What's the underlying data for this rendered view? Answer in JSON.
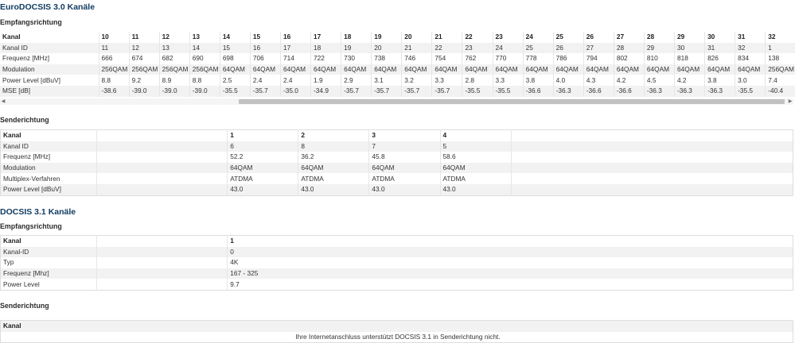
{
  "eurodocsis": {
    "title": "EuroDOCSIS 3.0 Kanäle",
    "downstream": {
      "title": "Empfangsrichtung",
      "header": [
        "Kanal",
        "10",
        "11",
        "12",
        "13",
        "14",
        "15",
        "16",
        "17",
        "18",
        "19",
        "20",
        "21",
        "22",
        "23",
        "24",
        "25",
        "26",
        "27",
        "28",
        "29",
        "30",
        "31",
        "32"
      ],
      "rows": [
        [
          "Kanal ID",
          "11",
          "12",
          "13",
          "14",
          "15",
          "16",
          "17",
          "18",
          "19",
          "20",
          "21",
          "22",
          "23",
          "24",
          "25",
          "26",
          "27",
          "28",
          "29",
          "30",
          "31",
          "32",
          "1"
        ],
        [
          "Frequenz [MHz]",
          "666",
          "674",
          "682",
          "690",
          "698",
          "706",
          "714",
          "722",
          "730",
          "738",
          "746",
          "754",
          "762",
          "770",
          "778",
          "786",
          "794",
          "802",
          "810",
          "818",
          "826",
          "834",
          "138"
        ],
        [
          "Modulation",
          "256QAM",
          "256QAM",
          "256QAM",
          "256QAM",
          "64QAM",
          "64QAM",
          "64QAM",
          "64QAM",
          "64QAM",
          "64QAM",
          "64QAM",
          "64QAM",
          "64QAM",
          "64QAM",
          "64QAM",
          "64QAM",
          "64QAM",
          "64QAM",
          "64QAM",
          "64QAM",
          "64QAM",
          "64QAM",
          "256QAM"
        ],
        [
          "Power Level [dBuV]",
          "8.8",
          "9.2",
          "8.9",
          "8.8",
          "2.5",
          "2.4",
          "2.4",
          "1.9",
          "2.9",
          "3.1",
          "3.2",
          "3.3",
          "2.8",
          "3.3",
          "3.8",
          "4.0",
          "4.3",
          "4.2",
          "4.5",
          "4.2",
          "3.8",
          "3.0",
          "7.4"
        ],
        [
          "MSE [dB]",
          "-38.6",
          "-39.0",
          "-39.0",
          "-39.0",
          "-35.5",
          "-35.7",
          "-35.0",
          "-34.9",
          "-35.7",
          "-35.7",
          "-35.7",
          "-35.7",
          "-35.5",
          "-35.5",
          "-36.6",
          "-36.3",
          "-36.6",
          "-36.6",
          "-36.3",
          "-36.3",
          "-36.3",
          "-35.5",
          "-40.4"
        ]
      ]
    },
    "upstream": {
      "title": "Senderichtung",
      "header": [
        "Kanal",
        "",
        "1",
        "2",
        "3",
        "4",
        ""
      ],
      "rows": [
        [
          "Kanal ID",
          "",
          "6",
          "8",
          "7",
          "5",
          ""
        ],
        [
          "Frequenz [MHz]",
          "",
          "52.2",
          "36.2",
          "45.8",
          "58.6",
          ""
        ],
        [
          "Modulation",
          "",
          "64QAM",
          "64QAM",
          "64QAM",
          "64QAM",
          ""
        ],
        [
          "Multiplex-Verfahren",
          "",
          "ATDMA",
          "ATDMA",
          "ATDMA",
          "ATDMA",
          ""
        ],
        [
          "Power Level [dBuV]",
          "",
          "43.0",
          "43.0",
          "43.0",
          "43.0",
          ""
        ]
      ]
    }
  },
  "docsis31": {
    "title": "DOCSIS 3.1 Kanäle",
    "downstream": {
      "title": "Empfangsrichtung",
      "header": [
        "Kanal",
        "",
        "1"
      ],
      "rows": [
        [
          "Kanal-ID",
          "",
          "0"
        ],
        [
          "Typ",
          "",
          "4K"
        ],
        [
          "Frequenz [Mhz]",
          "",
          "167 - 325"
        ],
        [
          "Power Level",
          "",
          "9.7"
        ]
      ]
    },
    "upstream": {
      "title": "Senderichtung",
      "header": [
        "Kanal"
      ],
      "note": "Ihre Internetanschluss unterstützt DOCSIS 3.1 in Senderichtung nicht."
    }
  },
  "scrollbar": {
    "left_arrow": "◀",
    "right_arrow": "▶",
    "position_fraction": 0.3
  }
}
